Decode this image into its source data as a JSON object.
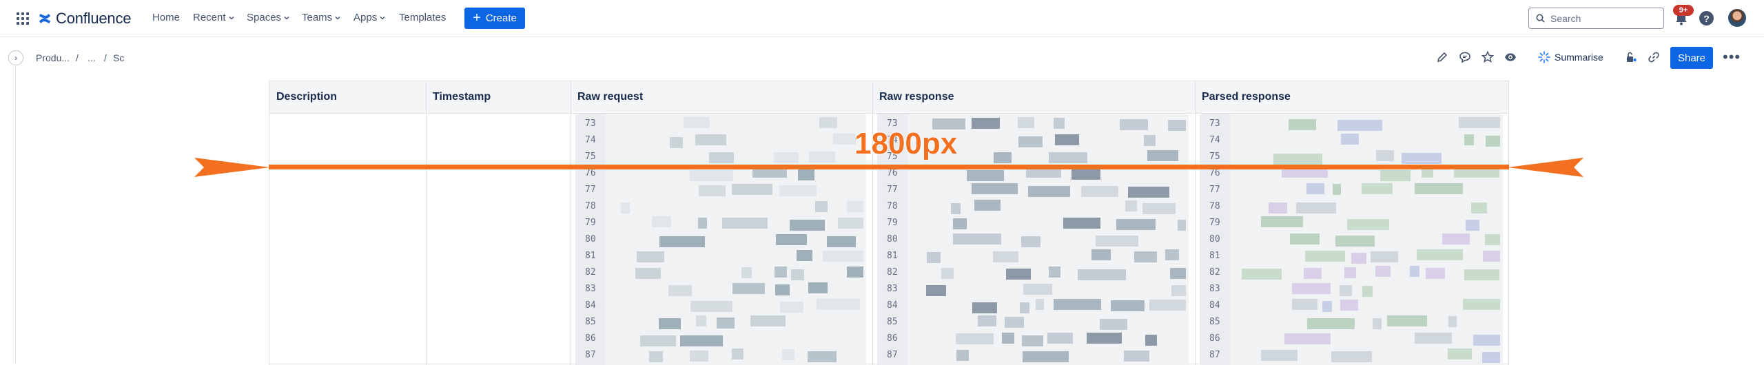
{
  "app": {
    "name": "Confluence"
  },
  "nav": {
    "items": [
      "Home",
      "Recent",
      "Spaces",
      "Teams",
      "Apps",
      "Templates"
    ],
    "create_label": "Create",
    "search_placeholder": "Search",
    "notifications_badge": "9+",
    "help_label": "?"
  },
  "breadcrumb": {
    "items": [
      "Produ...",
      "/",
      "...",
      "/",
      "Sc"
    ]
  },
  "toolbar": {
    "summarise_label": "Summarise",
    "share_label": "Share",
    "more_label": "•••"
  },
  "table": {
    "headers": [
      "Description",
      "Timestamp",
      "Raw request",
      "Raw response",
      "Parsed response"
    ],
    "line_numbers": [
      "73",
      "74",
      "75",
      "76",
      "77",
      "78",
      "79",
      "80",
      "81",
      "82",
      "83",
      "84",
      "85",
      "86",
      "87"
    ]
  },
  "annotation": {
    "label": "1800px",
    "color": "#F37020"
  },
  "colors": {
    "primary": "#0C66E4",
    "badge": "#C9372C",
    "annotation": "#F37020"
  }
}
